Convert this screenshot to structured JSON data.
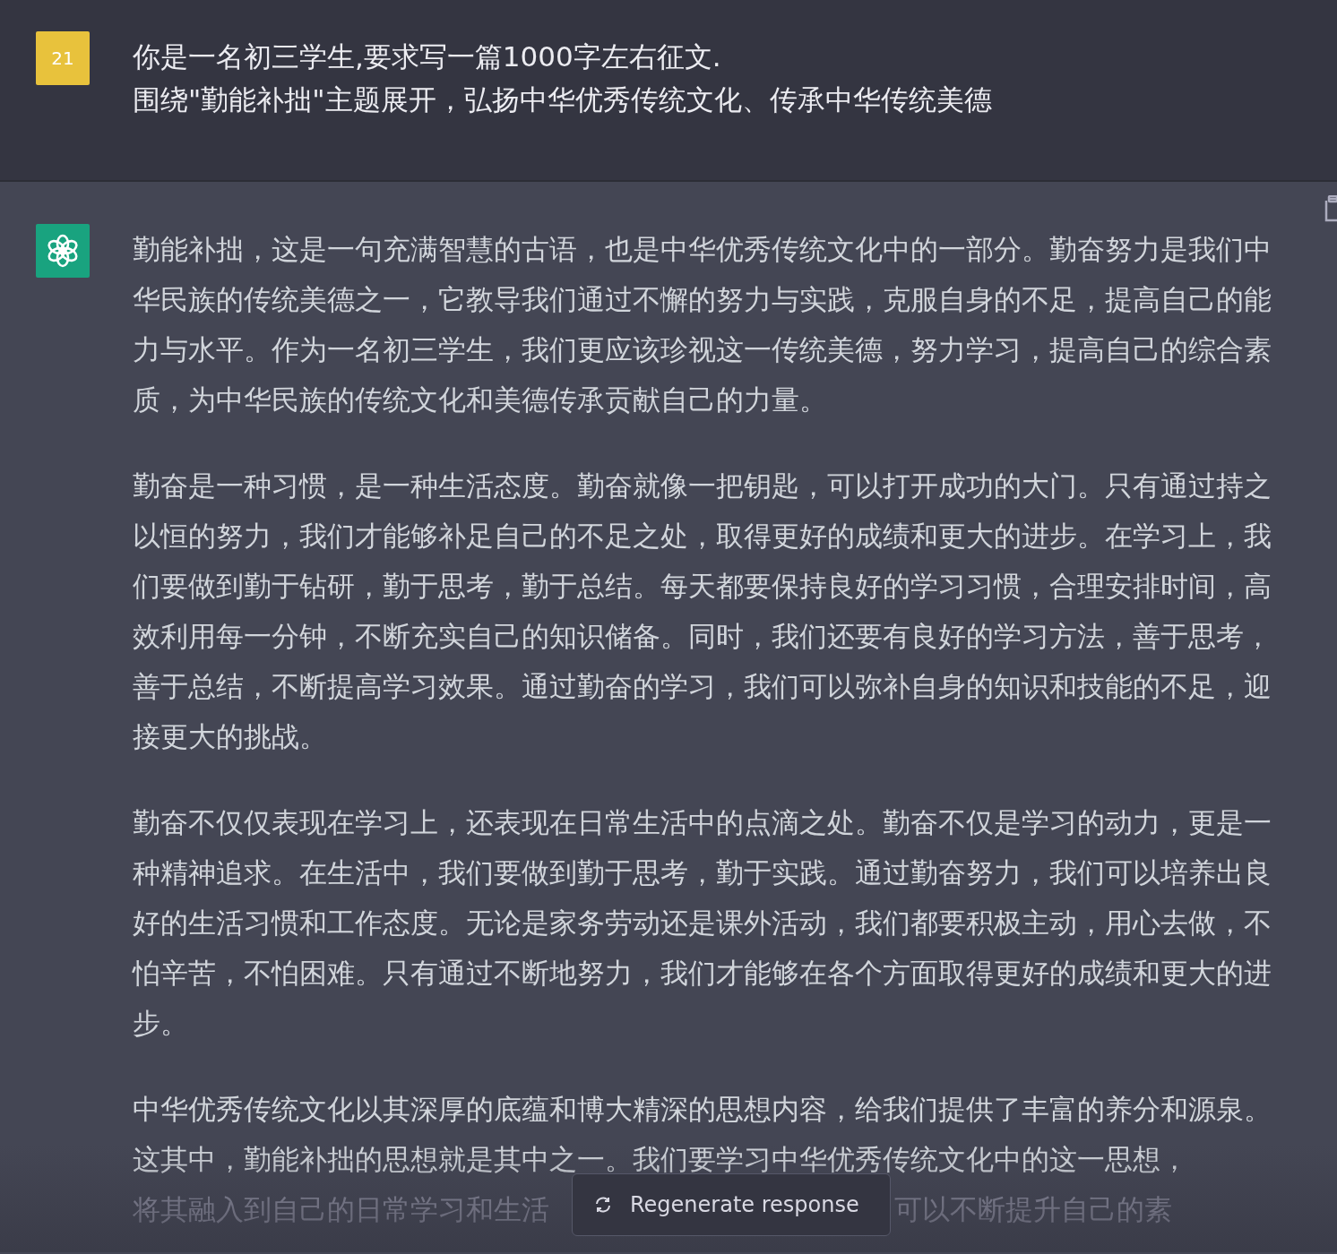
{
  "user_message": {
    "avatar": "21",
    "text": "你是一名初三学生,要求写一篇1000字左右征文.\n围绕\"勤能补拙\"主题展开，弘扬中华优秀传统文化、传承中华传统美德"
  },
  "assistant_message": {
    "paragraphs": [
      "勤能补拙，这是一句充满智慧的古语，也是中华优秀传统文化中的一部分。勤奋努力是我们中华民族的传统美德之一，它教导我们通过不懈的努力与实践，克服自身的不足，提高自己的能力与水平。作为一名初三学生，我们更应该珍视这一传统美德，努力学习，提高自己的综合素质，为中华民族的传统文化和美德传承贡献自己的力量。",
      "勤奋是一种习惯，是一种生活态度。勤奋就像一把钥匙，可以打开成功的大门。只有通过持之以恒的努力，我们才能够补足自己的不足之处，取得更好的成绩和更大的进步。在学习上，我们要做到勤于钻研，勤于思考，勤于总结。每天都要保持良好的学习习惯，合理安排时间，高效利用每一分钟，不断充实自己的知识储备。同时，我们还要有良好的学习方法，善于思考，善于总结，不断提高学习效果。通过勤奋的学习，我们可以弥补自身的知识和技能的不足，迎接更大的挑战。",
      "勤奋不仅仅表现在学习上，还表现在日常生活中的点滴之处。勤奋不仅是学习的动力，更是一种精神追求。在生活中，我们要做到勤于思考，勤于实践。通过勤奋努力，我们可以培养出良好的生活习惯和工作态度。无论是家务劳动还是课外活动，我们都要积极主动，用心去做，不怕辛苦，不怕困难。只有通过不断地努力，我们才能够在各个方面取得更好的成绩和更大的进步。",
      "中华优秀传统文化以其深厚的底蕴和博大精深的思想内容，给我们提供了丰富的养分和源泉。这其中，勤能补拙的思想就是其中之一。我们要学习中华优秀传统文化中的这一思想，"
    ],
    "partial_line": [
      "将其融入到自己的日常学习和生活",
      "可以不断提升自己的素"
    ]
  },
  "regenerate_button": {
    "label": "Regenerate response"
  }
}
